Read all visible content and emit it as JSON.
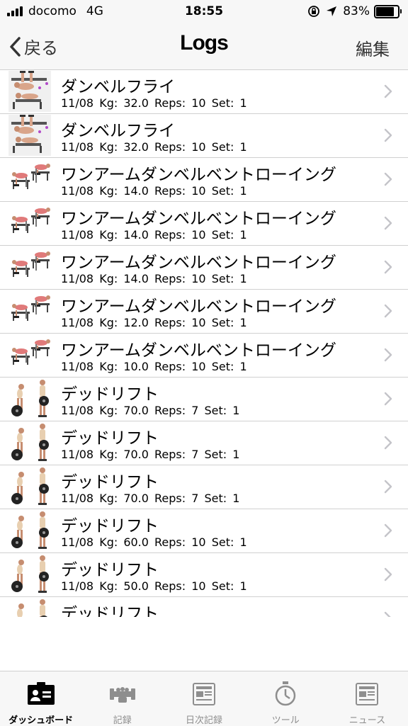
{
  "status_bar": {
    "carrier": "docomo",
    "network": "4G",
    "time": "18:55",
    "battery": "83%",
    "battery_level": 0.83
  },
  "nav": {
    "back_label": "戻る",
    "title": "Logs",
    "edit_label": "編集"
  },
  "logs": [
    {
      "exercise": "ダンベルフライ",
      "detail": "11/08 Kg: 32.0 Reps: 10 Set: 1",
      "thumb": "dumbbell-fly"
    },
    {
      "exercise": "ダンベルフライ",
      "detail": "11/08 Kg: 32.0 Reps: 10 Set: 1",
      "thumb": "dumbbell-fly"
    },
    {
      "exercise": "ワンアームダンベルベントローイング",
      "detail": "11/08 Kg: 14.0 Reps: 10 Set: 1",
      "thumb": "one-arm-row"
    },
    {
      "exercise": "ワンアームダンベルベントローイング",
      "detail": "11/08 Kg: 14.0 Reps: 10 Set: 1",
      "thumb": "one-arm-row"
    },
    {
      "exercise": "ワンアームダンベルベントローイング",
      "detail": "11/08 Kg: 14.0 Reps: 10 Set: 1",
      "thumb": "one-arm-row"
    },
    {
      "exercise": "ワンアームダンベルベントローイング",
      "detail": "11/08 Kg: 12.0 Reps: 10 Set: 1",
      "thumb": "one-arm-row"
    },
    {
      "exercise": "ワンアームダンベルベントローイング",
      "detail": "11/08 Kg: 10.0 Reps: 10 Set: 1",
      "thumb": "one-arm-row"
    },
    {
      "exercise": "デッドリフト",
      "detail": "11/08 Kg: 70.0 Reps: 7 Set: 1",
      "thumb": "deadlift"
    },
    {
      "exercise": "デッドリフト",
      "detail": "11/08 Kg: 70.0 Reps: 7 Set: 1",
      "thumb": "deadlift"
    },
    {
      "exercise": "デッドリフト",
      "detail": "11/08 Kg: 70.0 Reps: 7 Set: 1",
      "thumb": "deadlift"
    },
    {
      "exercise": "デッドリフト",
      "detail": "11/08 Kg: 60.0 Reps: 10 Set: 1",
      "thumb": "deadlift"
    },
    {
      "exercise": "デッドリフト",
      "detail": "11/08 Kg: 50.0 Reps: 10 Set: 1",
      "thumb": "deadlift"
    },
    {
      "exercise": "デッドリフト",
      "detail": "",
      "thumb": "deadlift"
    }
  ],
  "tabs": [
    {
      "label": "ダッシュボード",
      "icon": "dashboard-icon",
      "active": true
    },
    {
      "label": "記録",
      "icon": "dumbbell-icon",
      "active": false
    },
    {
      "label": "日次記録",
      "icon": "daily-record-icon",
      "active": false
    },
    {
      "label": "ツール",
      "icon": "stopwatch-icon",
      "active": false
    },
    {
      "label": "ニュース",
      "icon": "news-icon",
      "active": false
    }
  ],
  "colors": {
    "bar_background": "#f7f7f7",
    "separator": "#d0d0d0",
    "chevron": "#c4c4c9",
    "tab_inactive": "#8e8e8e",
    "tab_active": "#000000"
  }
}
